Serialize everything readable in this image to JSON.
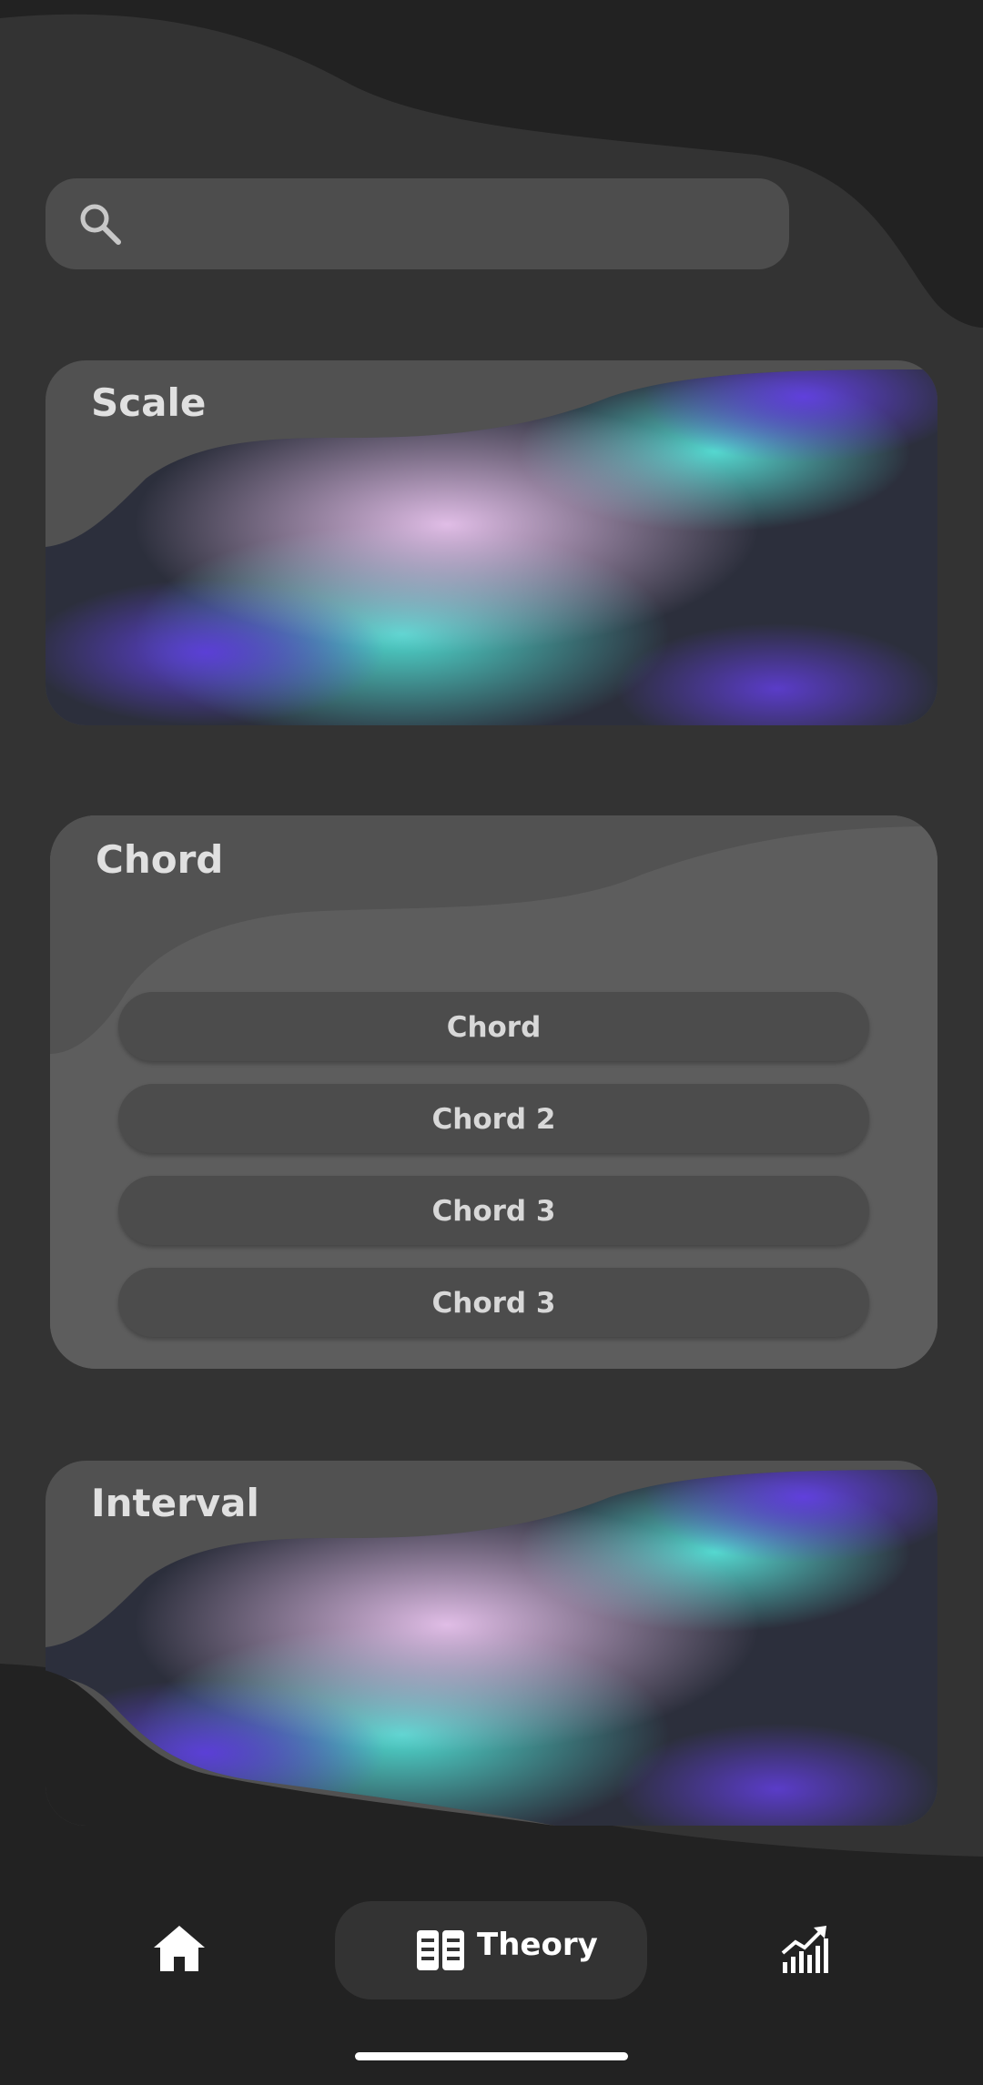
{
  "search": {
    "placeholder": "",
    "icon": "search-icon"
  },
  "cards": {
    "scale": {
      "title": "Scale"
    },
    "chord": {
      "title": "Chord",
      "items": [
        "Chord",
        "Chord 2",
        "Chord 3",
        "Chord 3"
      ]
    },
    "interval": {
      "title": "Interval"
    }
  },
  "nav": {
    "home_icon": "home-icon",
    "theory_label": "Theory",
    "theory_icon": "book-icon",
    "stats_icon": "stats-icon"
  },
  "colors": {
    "background": "#222222",
    "panel": "#333333",
    "card": "#515151",
    "chord_card": "#5d5d5d",
    "gradient_pink": "#d8b8e2",
    "gradient_teal": "#4fd6cc",
    "gradient_violet": "#5a3fd0"
  }
}
